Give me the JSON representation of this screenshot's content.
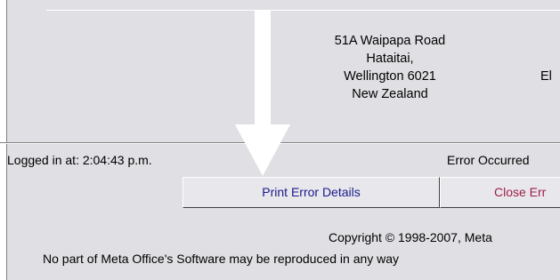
{
  "address": {
    "lines": [
      "51A Waipapa Road",
      "Hataitai,",
      "Wellington 6021",
      "New Zealand"
    ],
    "right_fragment": "El"
  },
  "status": {
    "logged_in": "Logged in at: 2:04:43 p.m.",
    "error_occurred": "Error Occurred"
  },
  "buttons": {
    "print_label": "Print Error Details",
    "close_label": "Close Err"
  },
  "footer": {
    "copyright": "Copyright © 1998-2007, Meta",
    "disclaimer": "No part of Meta Office's Software may be reproduced in any way"
  },
  "colors": {
    "panel_bg": "#e0dfe3",
    "print_text": "#1a1a8c",
    "close_text": "#a0204a",
    "arrow": "#ffffff"
  },
  "icons": {
    "arrow": "down-arrow-icon"
  }
}
